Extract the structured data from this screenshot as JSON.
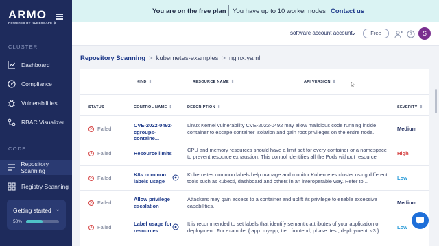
{
  "brand": {
    "logo_text": "ARMO",
    "logo_sub": "POWERED BY KUBESCAPE ⚙"
  },
  "sidebar": {
    "section_cluster": "CLUSTER",
    "section_code": "CODE",
    "items": [
      {
        "label": "Dashboard",
        "icon": "chart-icon"
      },
      {
        "label": "Compliance",
        "icon": "gauge-icon"
      },
      {
        "label": "Vulnerabilities",
        "icon": "bug-icon"
      },
      {
        "label": "RBAC Visualizer",
        "icon": "rbac-icon"
      },
      {
        "label": "Repository Scanning",
        "icon": "repo-icon",
        "active": true
      },
      {
        "label": "Registry Scanning",
        "icon": "registry-icon"
      }
    ],
    "getting_started": {
      "title": "Getting started",
      "chevron": "⌄",
      "percent_label": "50%",
      "progress": 0.5
    }
  },
  "banner": {
    "plan": "You are on the free plan",
    "nodes": "You have up to 10 worker nodes",
    "link": "Contact us"
  },
  "header": {
    "account": "software account account",
    "plan_badge": "Free",
    "avatar_initial": "S"
  },
  "breadcrumb": {
    "root": "Repository Scanning",
    "repo": "kubernetes-examples",
    "file": "nginx.yaml",
    "separator": ">"
  },
  "file_table": {
    "headers": {
      "kind": "KIND",
      "resource_name": "RESOURCE NAME",
      "api_version": "API VERSION"
    }
  },
  "controls_table": {
    "headers": {
      "status": "STATUS",
      "control_name": "CONTROL NAME",
      "description": "DESCRIPTION",
      "severity": "SEVERITY"
    },
    "rows": [
      {
        "status": "Failed",
        "control": "CVE-2022-0492-cgroups-containe...",
        "description": "Linux Kernel vulnerability CVE-2022-0492 may allow malicious code running inside container to escape container isolation and gain root privileges on the entire node. Whe...",
        "severity": "Medium",
        "severity_color": "#1e2b5c",
        "info": false
      },
      {
        "status": "Failed",
        "control": "Resource limits",
        "description": "CPU and memory resources should have a limit set for every container or a namespace to prevent resource exhaustion. This control identifies all the Pods without resource limit...",
        "severity": "High",
        "severity_color": "#d64545",
        "info": false
      },
      {
        "status": "Failed",
        "control": "K8s common labels usage",
        "description": "Kubernetes common labels help manage and monitor Kubernetes cluster using different tools such as kubectl, dashboard and others in an interoperable way. Refer to...",
        "severity": "Low",
        "severity_color": "#2a9bd8",
        "info": true
      },
      {
        "status": "Failed",
        "control": "Allow privilege escalation",
        "description": "Attackers may gain access to a container and uplift its privilege to enable excessive capabilities.",
        "severity": "Medium",
        "severity_color": "#1e2b5c",
        "info": false
      },
      {
        "status": "Failed",
        "control": "Label usage for resources",
        "description": "It is recommended to set labels that identify semantic attributes of your application or deployment. For example, { app: myapp, tier: frontend, phase: test, deployment: v3 }...",
        "severity": "Low",
        "severity_color": "#2a9bd8",
        "info": true
      }
    ]
  },
  "colors": {
    "sidebar": "#1e2b5c",
    "banner": "#daf3f3",
    "accent": "#1e3a8a",
    "progress": "#4fc2c8"
  }
}
